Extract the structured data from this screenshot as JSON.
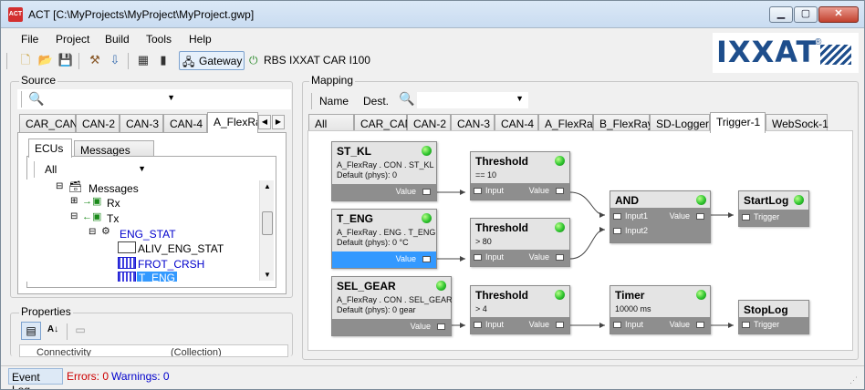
{
  "window": {
    "title": "ACT [C:\\MyProjects\\MyProject\\MyProject.gwp]",
    "icon": "ACT"
  },
  "menu": [
    "File",
    "Project",
    "Build",
    "Tools",
    "Help"
  ],
  "toolbar": {
    "gateway_label": "Gateway",
    "device_label": "RBS IXXAT CAR I100"
  },
  "logo": {
    "text": "IXXAT",
    "reg": "®"
  },
  "source": {
    "title": "Source",
    "tabs": [
      "CAR_CAN",
      "CAN-2",
      "CAN-3",
      "CAN-4",
      "A_FlexRay"
    ],
    "subtabs": [
      "ECUs",
      "Messages"
    ],
    "filter": "All",
    "tree": {
      "messages": "Messages",
      "rx": "Rx",
      "tx": "Tx",
      "ecu": "ENG_STAT",
      "signals": [
        "ALIV_ENG_STAT",
        "FROT_CRSH",
        "T_ENG"
      ]
    }
  },
  "properties": {
    "title": "Properties",
    "row_name": "Connectivity",
    "row_value": "(Collection)"
  },
  "mapping": {
    "title": "Mapping",
    "name_label": "Name",
    "dest_label": "Dest.",
    "tabs": [
      "All",
      "CAR_CAN",
      "CAN-2",
      "CAN-3",
      "CAN-4",
      "A_FlexRay",
      "B_FlexRay",
      "SD-Logger",
      "Trigger-1",
      "WebSock-1"
    ],
    "active_tab": "Trigger-1"
  },
  "nodes": {
    "st_kl": {
      "title": "ST_KL",
      "line1": "A_FlexRay . CON . ST_KL",
      "line2": "Default (phys): 0",
      "out": "Value"
    },
    "t_eng": {
      "title": "T_ENG",
      "line1": "A_FlexRay . ENG . T_ENG",
      "line2": "Default (phys): 0 °C",
      "out": "Value"
    },
    "sel_gear": {
      "title": "SEL_GEAR",
      "line1": "A_FlexRay . CON . SEL_GEAR",
      "line2": "Default (phys): 0 gear",
      "out": "Value"
    },
    "thr1": {
      "title": "Threshold",
      "line1": "== 10",
      "in": "Input",
      "out": "Value"
    },
    "thr2": {
      "title": "Threshold",
      "line1": "> 80",
      "in": "Input",
      "out": "Value"
    },
    "thr3": {
      "title": "Threshold",
      "line1": "> 4",
      "in": "Input",
      "out": "Value"
    },
    "and": {
      "title": "AND",
      "in1": "Input1",
      "in2": "Input2",
      "out": "Value"
    },
    "timer": {
      "title": "Timer",
      "line1": "10000 ms",
      "in": "Input",
      "out": "Value"
    },
    "startlog": {
      "title": "StartLog",
      "in": "Trigger"
    },
    "stoplog": {
      "title": "StopLog",
      "in": "Trigger"
    }
  },
  "status": {
    "event_log": "Event Log",
    "errors": "Errors: 0",
    "warnings": "Warnings: 0"
  },
  "colors": {
    "accent": "#3399ff",
    "node_footer": "#8e8e8e",
    "led": "#2ec52e",
    "errors": "#cc0000",
    "warnings": "#0000cc"
  }
}
